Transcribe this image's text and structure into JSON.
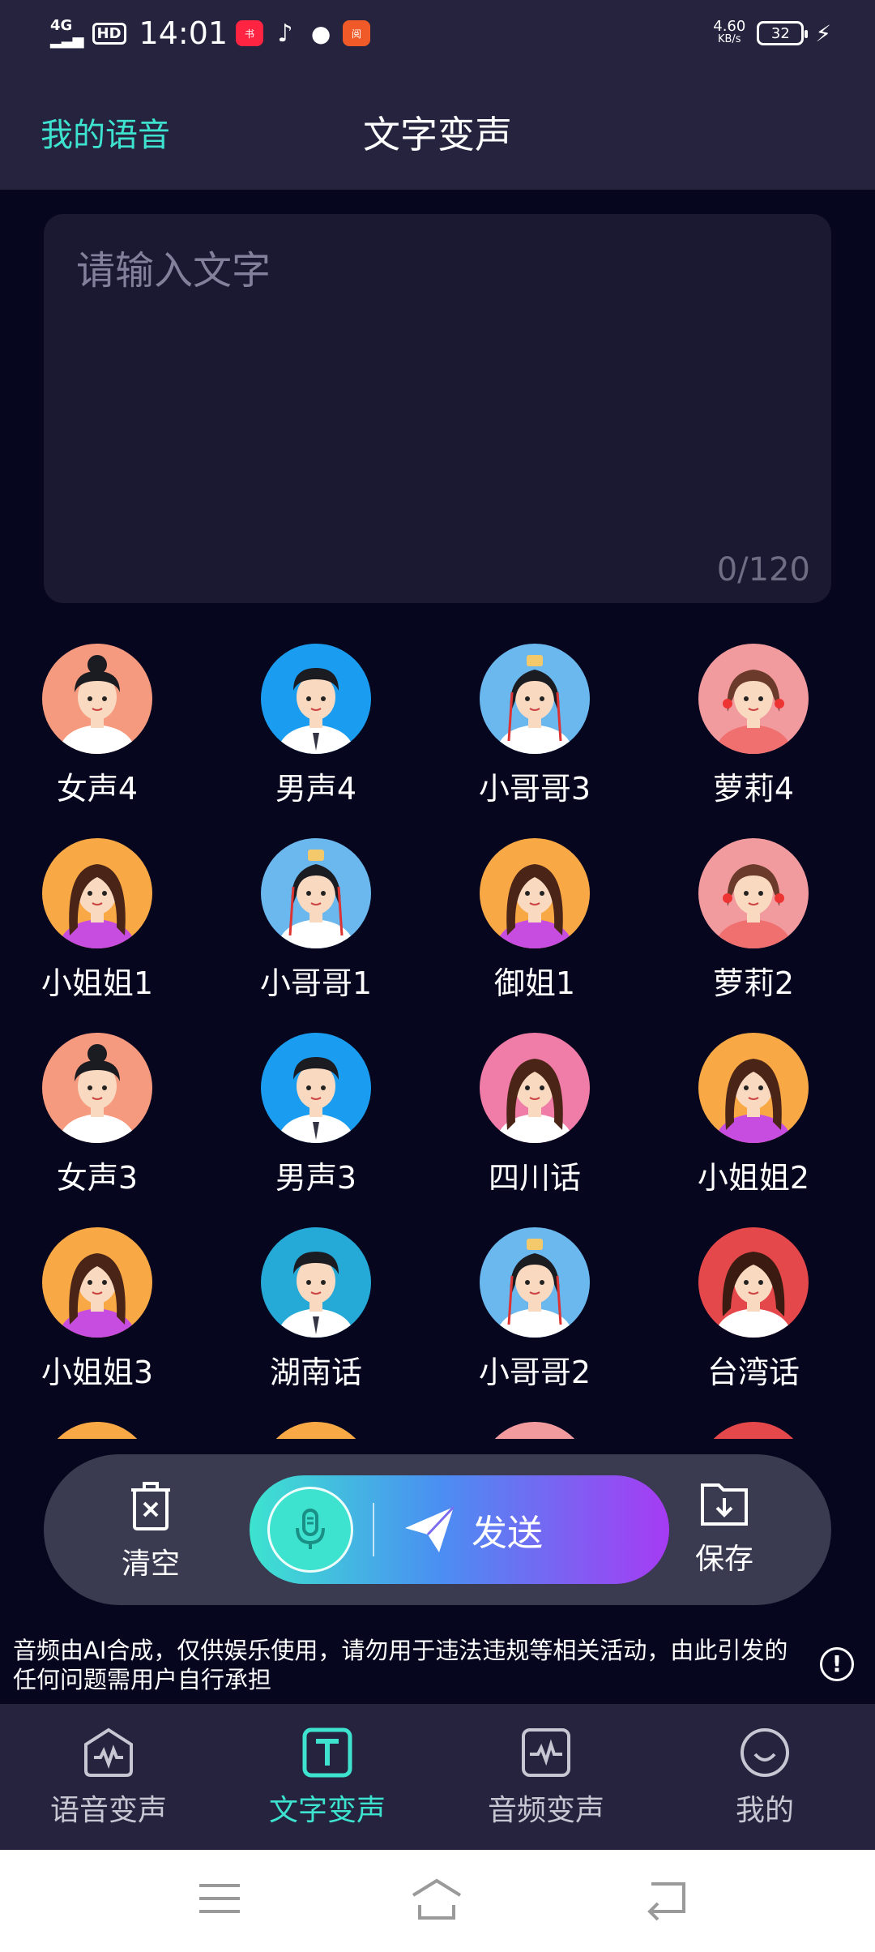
{
  "status_bar": {
    "network": "4G",
    "hd": "HD",
    "time": "14:01",
    "app_icons": [
      "小红书-icon",
      "tiktok-icon",
      "message-icon",
      "yuewen-icon"
    ],
    "speed_value": "4.60",
    "speed_unit": "KB/s",
    "battery": "32"
  },
  "header": {
    "my_voice": "我的语音",
    "title": "文字变声"
  },
  "text_input": {
    "placeholder": "请输入文字",
    "counter": "0/120"
  },
  "voices": [
    {
      "label": "女声4",
      "type": "woman-bun",
      "bg": "#f59a7e"
    },
    {
      "label": "男声4",
      "type": "man-suit",
      "bg": "#1a9df0"
    },
    {
      "label": "小哥哥3",
      "type": "ancient-boy",
      "bg": "#6ab8ee"
    },
    {
      "label": "萝莉4",
      "type": "loli",
      "bg": "#f29b9f"
    },
    {
      "label": "小姐姐1",
      "type": "lady",
      "bg": "#f8a946"
    },
    {
      "label": "小哥哥1",
      "type": "ancient-boy",
      "bg": "#6ab8ee"
    },
    {
      "label": "御姐1",
      "type": "lady",
      "bg": "#f8a946"
    },
    {
      "label": "萝莉2",
      "type": "loli",
      "bg": "#f29b9f"
    },
    {
      "label": "女声3",
      "type": "woman-bun",
      "bg": "#f59a7e"
    },
    {
      "label": "男声3",
      "type": "man-suit",
      "bg": "#1a9df0"
    },
    {
      "label": "四川话",
      "type": "lady-pink",
      "bg": "#f07ca8"
    },
    {
      "label": "小姐姐2",
      "type": "lady",
      "bg": "#f8a946"
    },
    {
      "label": "小姐姐3",
      "type": "lady",
      "bg": "#f8a946"
    },
    {
      "label": "湖南话",
      "type": "man-tie",
      "bg": "#25a9d6"
    },
    {
      "label": "小哥哥2",
      "type": "ancient-boy",
      "bg": "#6ab8ee"
    },
    {
      "label": "台湾话",
      "type": "girl-red",
      "bg": "#e5484a"
    },
    {
      "label": "",
      "type": "lady",
      "bg": "#f8a946"
    },
    {
      "label": "",
      "type": "lady",
      "bg": "#f8a946"
    },
    {
      "label": "",
      "type": "loli",
      "bg": "#f29b9f"
    },
    {
      "label": "",
      "type": "girl-red",
      "bg": "#e5484a"
    }
  ],
  "actions": {
    "clear": "清空",
    "send": "发送",
    "save": "保存"
  },
  "disclaimer": "音频由AI合成，仅供娱乐使用，请勿用于违法违规等相关活动，由此引发的任何问题需用户自行承担",
  "bottom_nav": [
    {
      "label": "语音变声",
      "icon": "voice-change-icon",
      "active": false
    },
    {
      "label": "文字变声",
      "icon": "text-change-icon",
      "active": true
    },
    {
      "label": "音频变声",
      "icon": "audio-change-icon",
      "active": false
    },
    {
      "label": "我的",
      "icon": "profile-icon",
      "active": false
    }
  ],
  "colors": {
    "accent": "#3de3cf",
    "background": "#07061f",
    "panel": "#25233e"
  }
}
